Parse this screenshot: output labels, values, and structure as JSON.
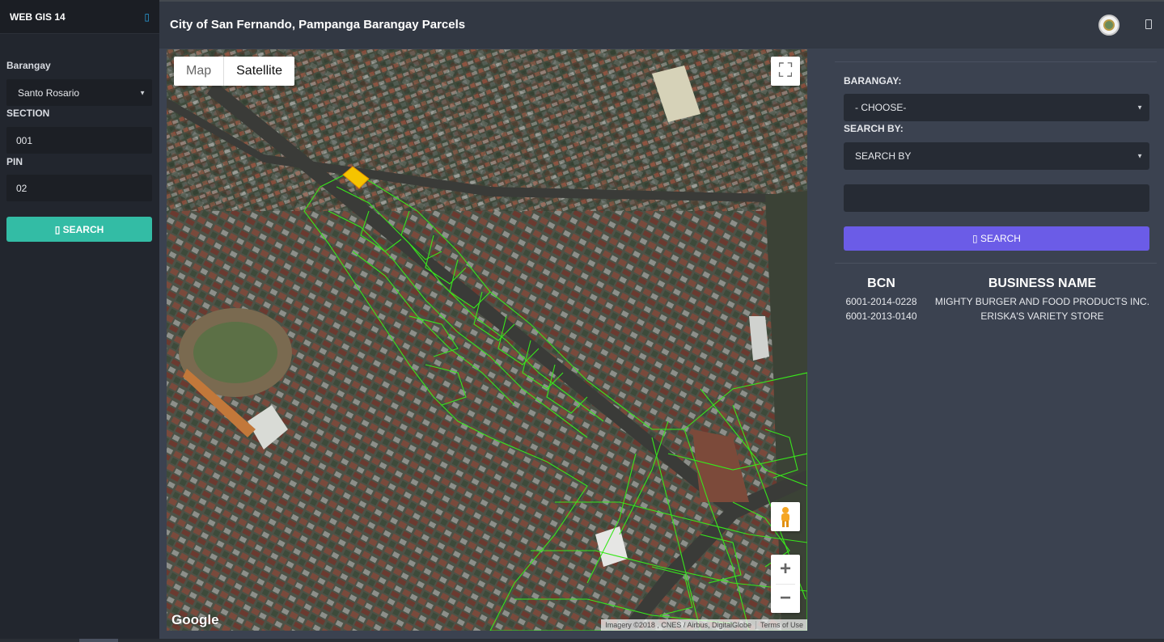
{
  "app": {
    "brand": "WEB GIS 14",
    "title": "City of San Fernando, Pampanga Barangay Parcels"
  },
  "sidebar": {
    "barangay_label": "Barangay",
    "barangay_value": "Santo Rosario",
    "section_label": "SECTION",
    "section_value": "001",
    "pin_label": "PIN",
    "pin_value": "02",
    "search_label": "▯ SEARCH"
  },
  "map": {
    "type_map": "Map",
    "type_satellite": "Satellite",
    "selected_type": "Satellite",
    "fullscreen_icon": "⛶",
    "zoom_in": "+",
    "zoom_out": "−",
    "logo": "Google",
    "attribution": "Imagery ©2018 , CNES / Airbus, DigitalGlobe",
    "terms": "Terms of Use"
  },
  "search_panel": {
    "barangay_label": "BARANGAY:",
    "barangay_value": "- CHOOSE-",
    "search_by_label": "SEARCH BY:",
    "search_by_value": "SEARCH BY",
    "query_value": "",
    "search_button": "▯ SEARCH"
  },
  "results": {
    "headers": [
      "BCN",
      "BUSINESS NAME"
    ],
    "rows": [
      {
        "bcn": "6001-2014-0228",
        "name": "MIGHTY BURGER AND FOOD PRODUCTS INC."
      },
      {
        "bcn": "6001-2013-0140",
        "name": "ERISKA'S VARIETY STORE"
      }
    ]
  },
  "colors": {
    "sidebar_search": "#33bca5",
    "panel_search": "#6b5ce7",
    "parcel_outline": "#39e61c",
    "selected_parcel": "#f5c400"
  }
}
